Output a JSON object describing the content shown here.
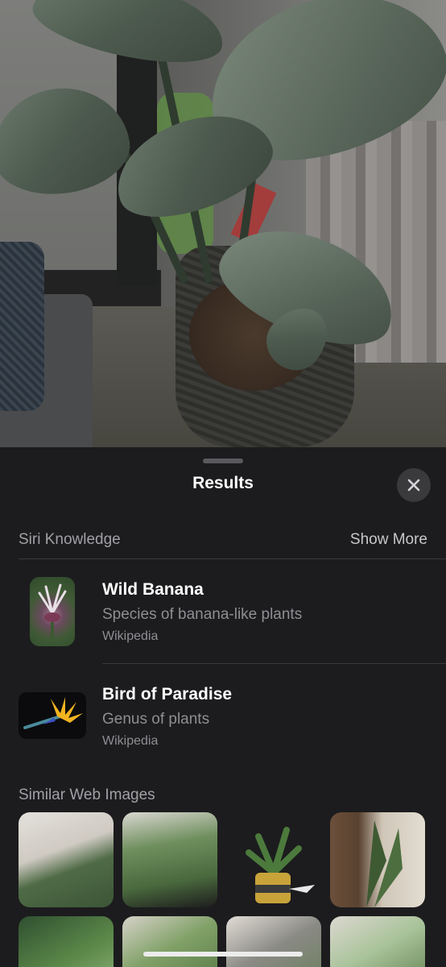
{
  "sheet": {
    "title": "Results",
    "close_icon": "xmark-icon"
  },
  "siri_knowledge": {
    "header": "Siri Knowledge",
    "show_more": "Show More",
    "results": [
      {
        "title": "Wild Banana",
        "subtitle": "Species of banana-like plants",
        "source": "Wikipedia"
      },
      {
        "title": "Bird of Paradise",
        "subtitle": "Genus of plants",
        "source": "Wikipedia"
      }
    ]
  },
  "similar_images": {
    "header": "Similar Web Images",
    "count_visible": 8
  },
  "colors": {
    "sheet_background": "#1c1c1e",
    "primary_text": "#ffffff",
    "secondary_text": "#8e8e93",
    "divider": "#3a3a3c"
  }
}
